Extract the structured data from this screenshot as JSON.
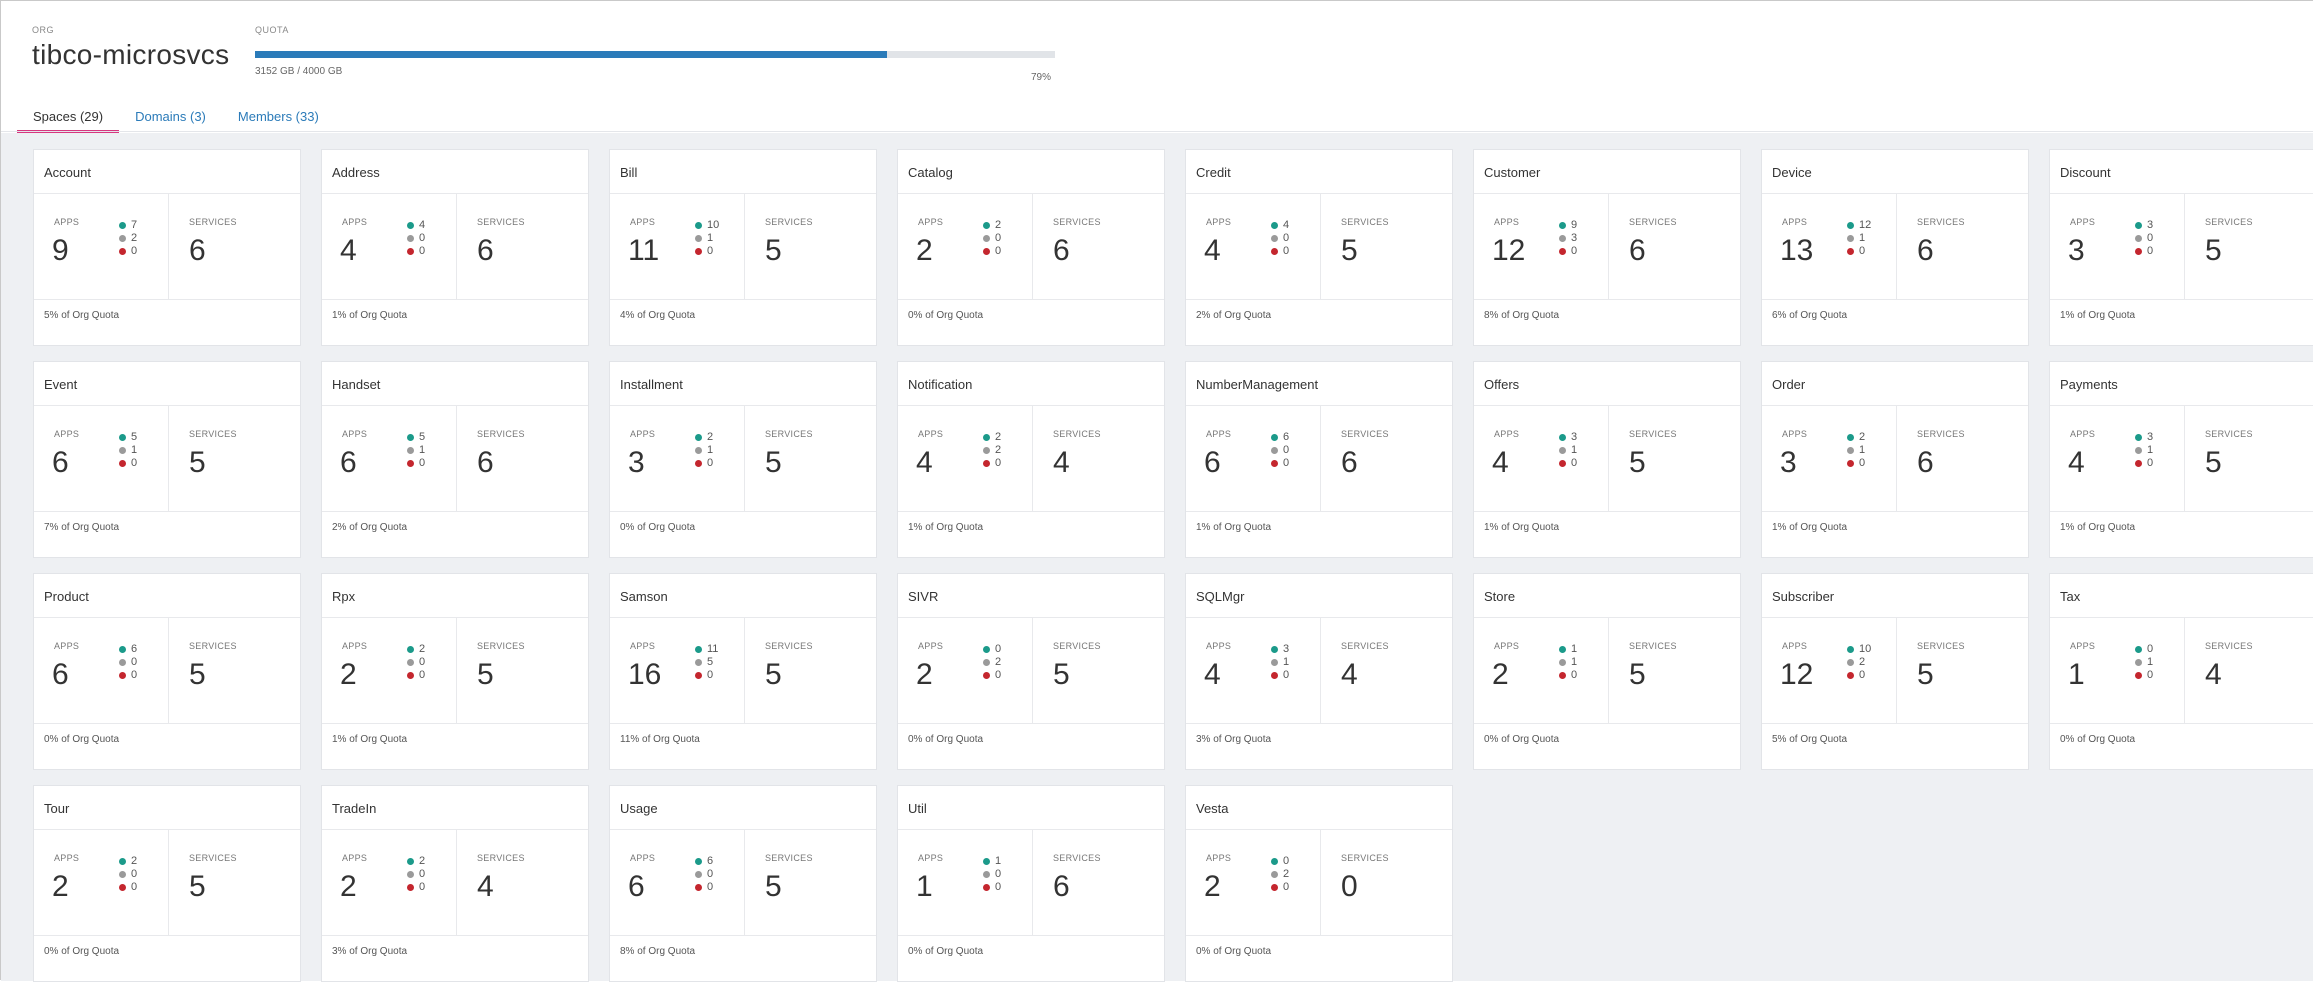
{
  "org": {
    "label": "ORG",
    "name": "tibco-microsvcs"
  },
  "quota": {
    "label": "QUOTA",
    "used_text": "3152 GB / 4000 GB",
    "percent_text": "79%",
    "fraction": 0.79,
    "color": "#2b7bb9"
  },
  "tabs": [
    {
      "label": "Spaces (29)",
      "active": true
    },
    {
      "label": "Domains (3)",
      "active": false
    },
    {
      "label": "Members (33)",
      "active": false
    }
  ],
  "labels": {
    "apps": "APPS",
    "services": "SERVICES"
  },
  "colors": {
    "running": "#1b9a8a",
    "stopped": "#9a9a9a",
    "crashed": "#c4262e",
    "active_tab": "#d6377f"
  },
  "spaces": [
    {
      "name": "Account",
      "apps": "9",
      "running": "7",
      "stopped": "2",
      "crashed": "0",
      "services": "6",
      "quota": "5% of Org Quota"
    },
    {
      "name": "Address",
      "apps": "4",
      "running": "4",
      "stopped": "0",
      "crashed": "0",
      "services": "6",
      "quota": "1% of Org Quota"
    },
    {
      "name": "Bill",
      "apps": "11",
      "running": "10",
      "stopped": "1",
      "crashed": "0",
      "services": "5",
      "quota": "4% of Org Quota"
    },
    {
      "name": "Catalog",
      "apps": "2",
      "running": "2",
      "stopped": "0",
      "crashed": "0",
      "services": "6",
      "quota": "0% of Org Quota"
    },
    {
      "name": "Credit",
      "apps": "4",
      "running": "4",
      "stopped": "0",
      "crashed": "0",
      "services": "5",
      "quota": "2% of Org Quota"
    },
    {
      "name": "Customer",
      "apps": "12",
      "running": "9",
      "stopped": "3",
      "crashed": "0",
      "services": "6",
      "quota": "8% of Org Quota"
    },
    {
      "name": "Device",
      "apps": "13",
      "running": "12",
      "stopped": "1",
      "crashed": "0",
      "services": "6",
      "quota": "6% of Org Quota"
    },
    {
      "name": "Discount",
      "apps": "3",
      "running": "3",
      "stopped": "0",
      "crashed": "0",
      "services": "5",
      "quota": "1% of Org Quota"
    },
    {
      "name": "Event",
      "apps": "6",
      "running": "5",
      "stopped": "1",
      "crashed": "0",
      "services": "5",
      "quota": "7% of Org Quota"
    },
    {
      "name": "Handset",
      "apps": "6",
      "running": "5",
      "stopped": "1",
      "crashed": "0",
      "services": "6",
      "quota": "2% of Org Quota"
    },
    {
      "name": "Installment",
      "apps": "3",
      "running": "2",
      "stopped": "1",
      "crashed": "0",
      "services": "5",
      "quota": "0% of Org Quota"
    },
    {
      "name": "Notification",
      "apps": "4",
      "running": "2",
      "stopped": "2",
      "crashed": "0",
      "services": "4",
      "quota": "1% of Org Quota"
    },
    {
      "name": "NumberManagement",
      "apps": "6",
      "running": "6",
      "stopped": "0",
      "crashed": "0",
      "services": "6",
      "quota": "1% of Org Quota"
    },
    {
      "name": "Offers",
      "apps": "4",
      "running": "3",
      "stopped": "1",
      "crashed": "0",
      "services": "5",
      "quota": "1% of Org Quota"
    },
    {
      "name": "Order",
      "apps": "3",
      "running": "2",
      "stopped": "1",
      "crashed": "0",
      "services": "6",
      "quota": "1% of Org Quota"
    },
    {
      "name": "Payments",
      "apps": "4",
      "running": "3",
      "stopped": "1",
      "crashed": "0",
      "services": "5",
      "quota": "1% of Org Quota"
    },
    {
      "name": "Product",
      "apps": "6",
      "running": "6",
      "stopped": "0",
      "crashed": "0",
      "services": "5",
      "quota": "0% of Org Quota"
    },
    {
      "name": "Rpx",
      "apps": "2",
      "running": "2",
      "stopped": "0",
      "crashed": "0",
      "services": "5",
      "quota": "1% of Org Quota"
    },
    {
      "name": "Samson",
      "apps": "16",
      "running": "11",
      "stopped": "5",
      "crashed": "0",
      "services": "5",
      "quota": "11% of Org Quota"
    },
    {
      "name": "SIVR",
      "apps": "2",
      "running": "0",
      "stopped": "2",
      "crashed": "0",
      "services": "5",
      "quota": "0% of Org Quota"
    },
    {
      "name": "SQLMgr",
      "apps": "4",
      "running": "3",
      "stopped": "1",
      "crashed": "0",
      "services": "4",
      "quota": "3% of Org Quota"
    },
    {
      "name": "Store",
      "apps": "2",
      "running": "1",
      "stopped": "1",
      "crashed": "0",
      "services": "5",
      "quota": "0% of Org Quota"
    },
    {
      "name": "Subscriber",
      "apps": "12",
      "running": "10",
      "stopped": "2",
      "crashed": "0",
      "services": "5",
      "quota": "5% of Org Quota"
    },
    {
      "name": "Tax",
      "apps": "1",
      "running": "0",
      "stopped": "1",
      "crashed": "0",
      "services": "4",
      "quota": "0% of Org Quota"
    },
    {
      "name": "Tour",
      "apps": "2",
      "running": "2",
      "stopped": "0",
      "crashed": "0",
      "services": "5",
      "quota": "0% of Org Quota"
    },
    {
      "name": "TradeIn",
      "apps": "2",
      "running": "2",
      "stopped": "0",
      "crashed": "0",
      "services": "4",
      "quota": "3% of Org Quota"
    },
    {
      "name": "Usage",
      "apps": "6",
      "running": "6",
      "stopped": "0",
      "crashed": "0",
      "services": "5",
      "quota": "8% of Org Quota"
    },
    {
      "name": "Util",
      "apps": "1",
      "running": "1",
      "stopped": "0",
      "crashed": "0",
      "services": "6",
      "quota": "0% of Org Quota"
    },
    {
      "name": "Vesta",
      "apps": "2",
      "running": "0",
      "stopped": "2",
      "crashed": "0",
      "services": "0",
      "quota": "0% of Org Quota"
    }
  ]
}
